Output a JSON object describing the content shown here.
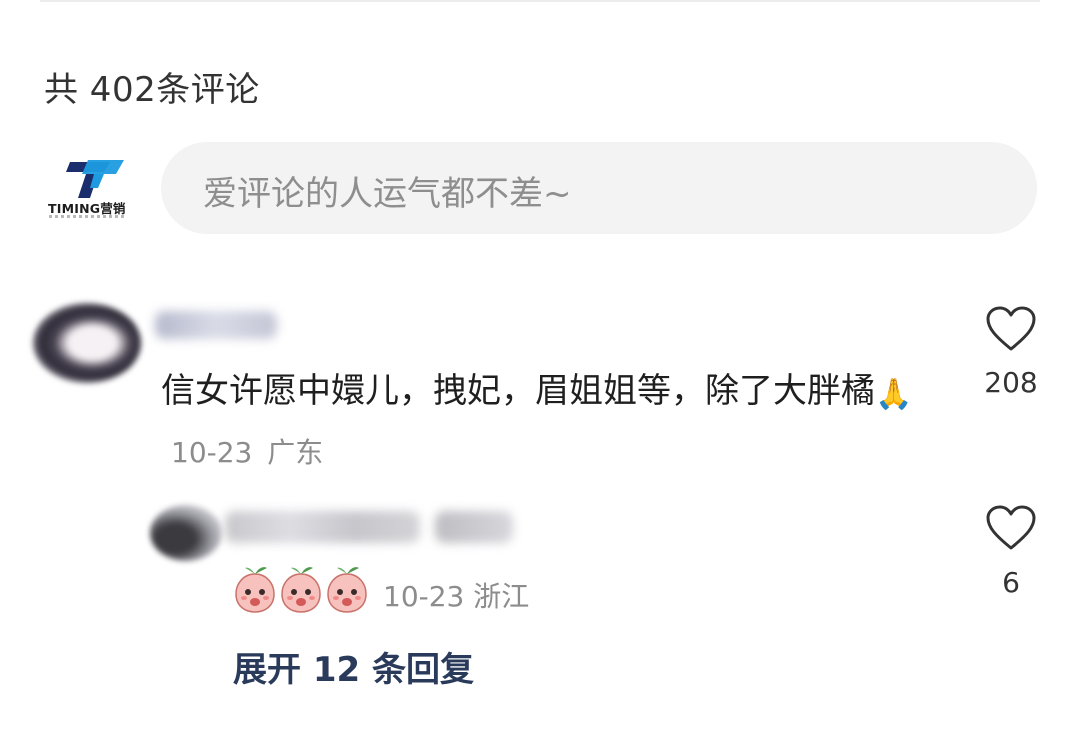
{
  "comments_header": {
    "count_text": "共 402条评论"
  },
  "logo": {
    "text": "TIMING营销"
  },
  "input": {
    "placeholder": "爱评论的人运气都不差~"
  },
  "comments": [
    {
      "text": "信女许愿中嬛儿，拽妃，眉姐姐等，除了大胖橘",
      "emoji": "🙏",
      "date": "10-23",
      "location": "广东",
      "likes": "208",
      "reply": {
        "date": "10-23",
        "location": "浙江",
        "likes": "6"
      },
      "expand_label": "展开 12 条回复"
    }
  ],
  "icons": {
    "like": "heart-outline-icon",
    "sticker": "peach-sticker-icon"
  },
  "colors": {
    "expand_link": "#2a3a5a",
    "meta_text": "#8c8c8c",
    "input_bg": "#f3f3f3"
  }
}
